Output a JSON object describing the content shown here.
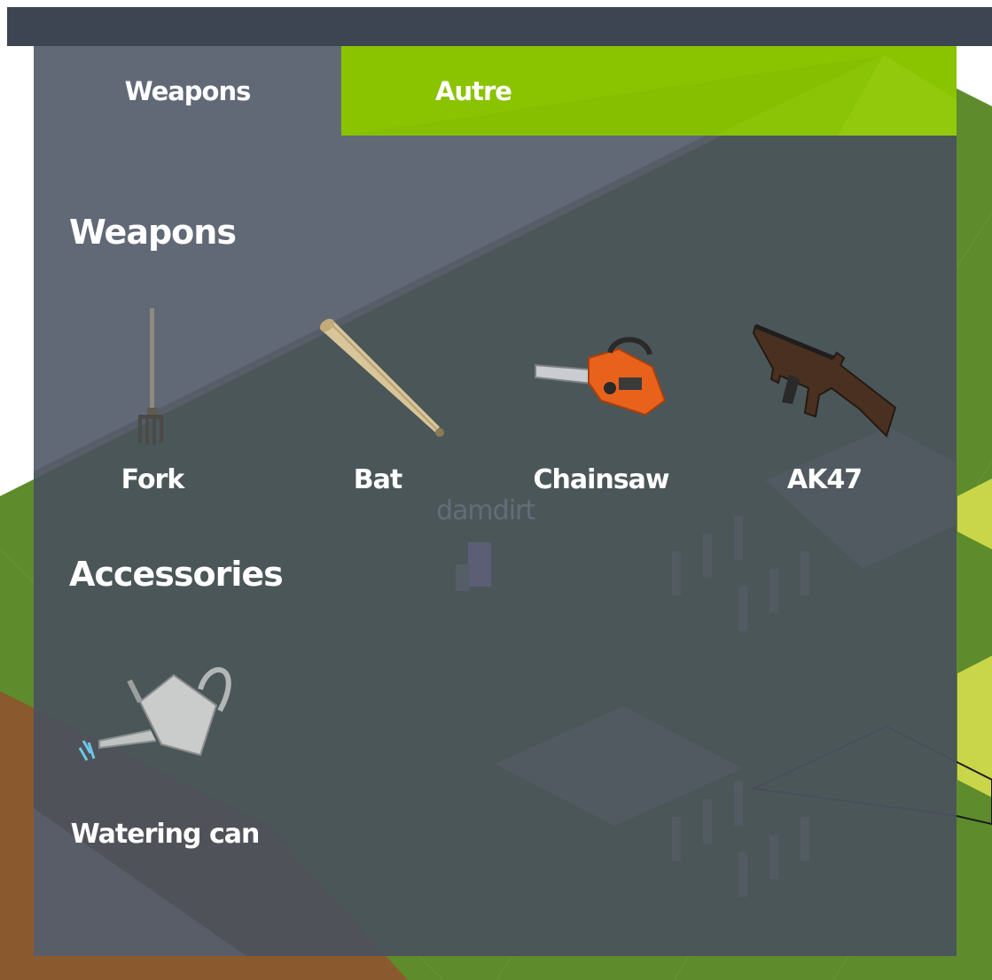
{
  "tabs": [
    {
      "label": "Weapons",
      "active": true
    },
    {
      "label": "Autre",
      "active": false
    }
  ],
  "sections": {
    "weapons": {
      "title": "Weapons",
      "items": [
        {
          "label": "Fork",
          "icon": "pitchfork-icon"
        },
        {
          "label": "Bat",
          "icon": "baseball-bat-icon"
        },
        {
          "label": "Chainsaw",
          "icon": "chainsaw-icon"
        },
        {
          "label": "AK47",
          "icon": "rifle-icon"
        }
      ]
    },
    "accessories": {
      "title": "Accessories",
      "items": [
        {
          "label": "Watering can",
          "icon": "watering-can-icon"
        }
      ]
    }
  },
  "watermark": "damdirt",
  "colors": {
    "topbar": "#3d4452",
    "panel": "#4a525c",
    "tab_active_accent": "#8ac300",
    "grass": "#5d8a2a",
    "soil": "#8a5a2e"
  }
}
